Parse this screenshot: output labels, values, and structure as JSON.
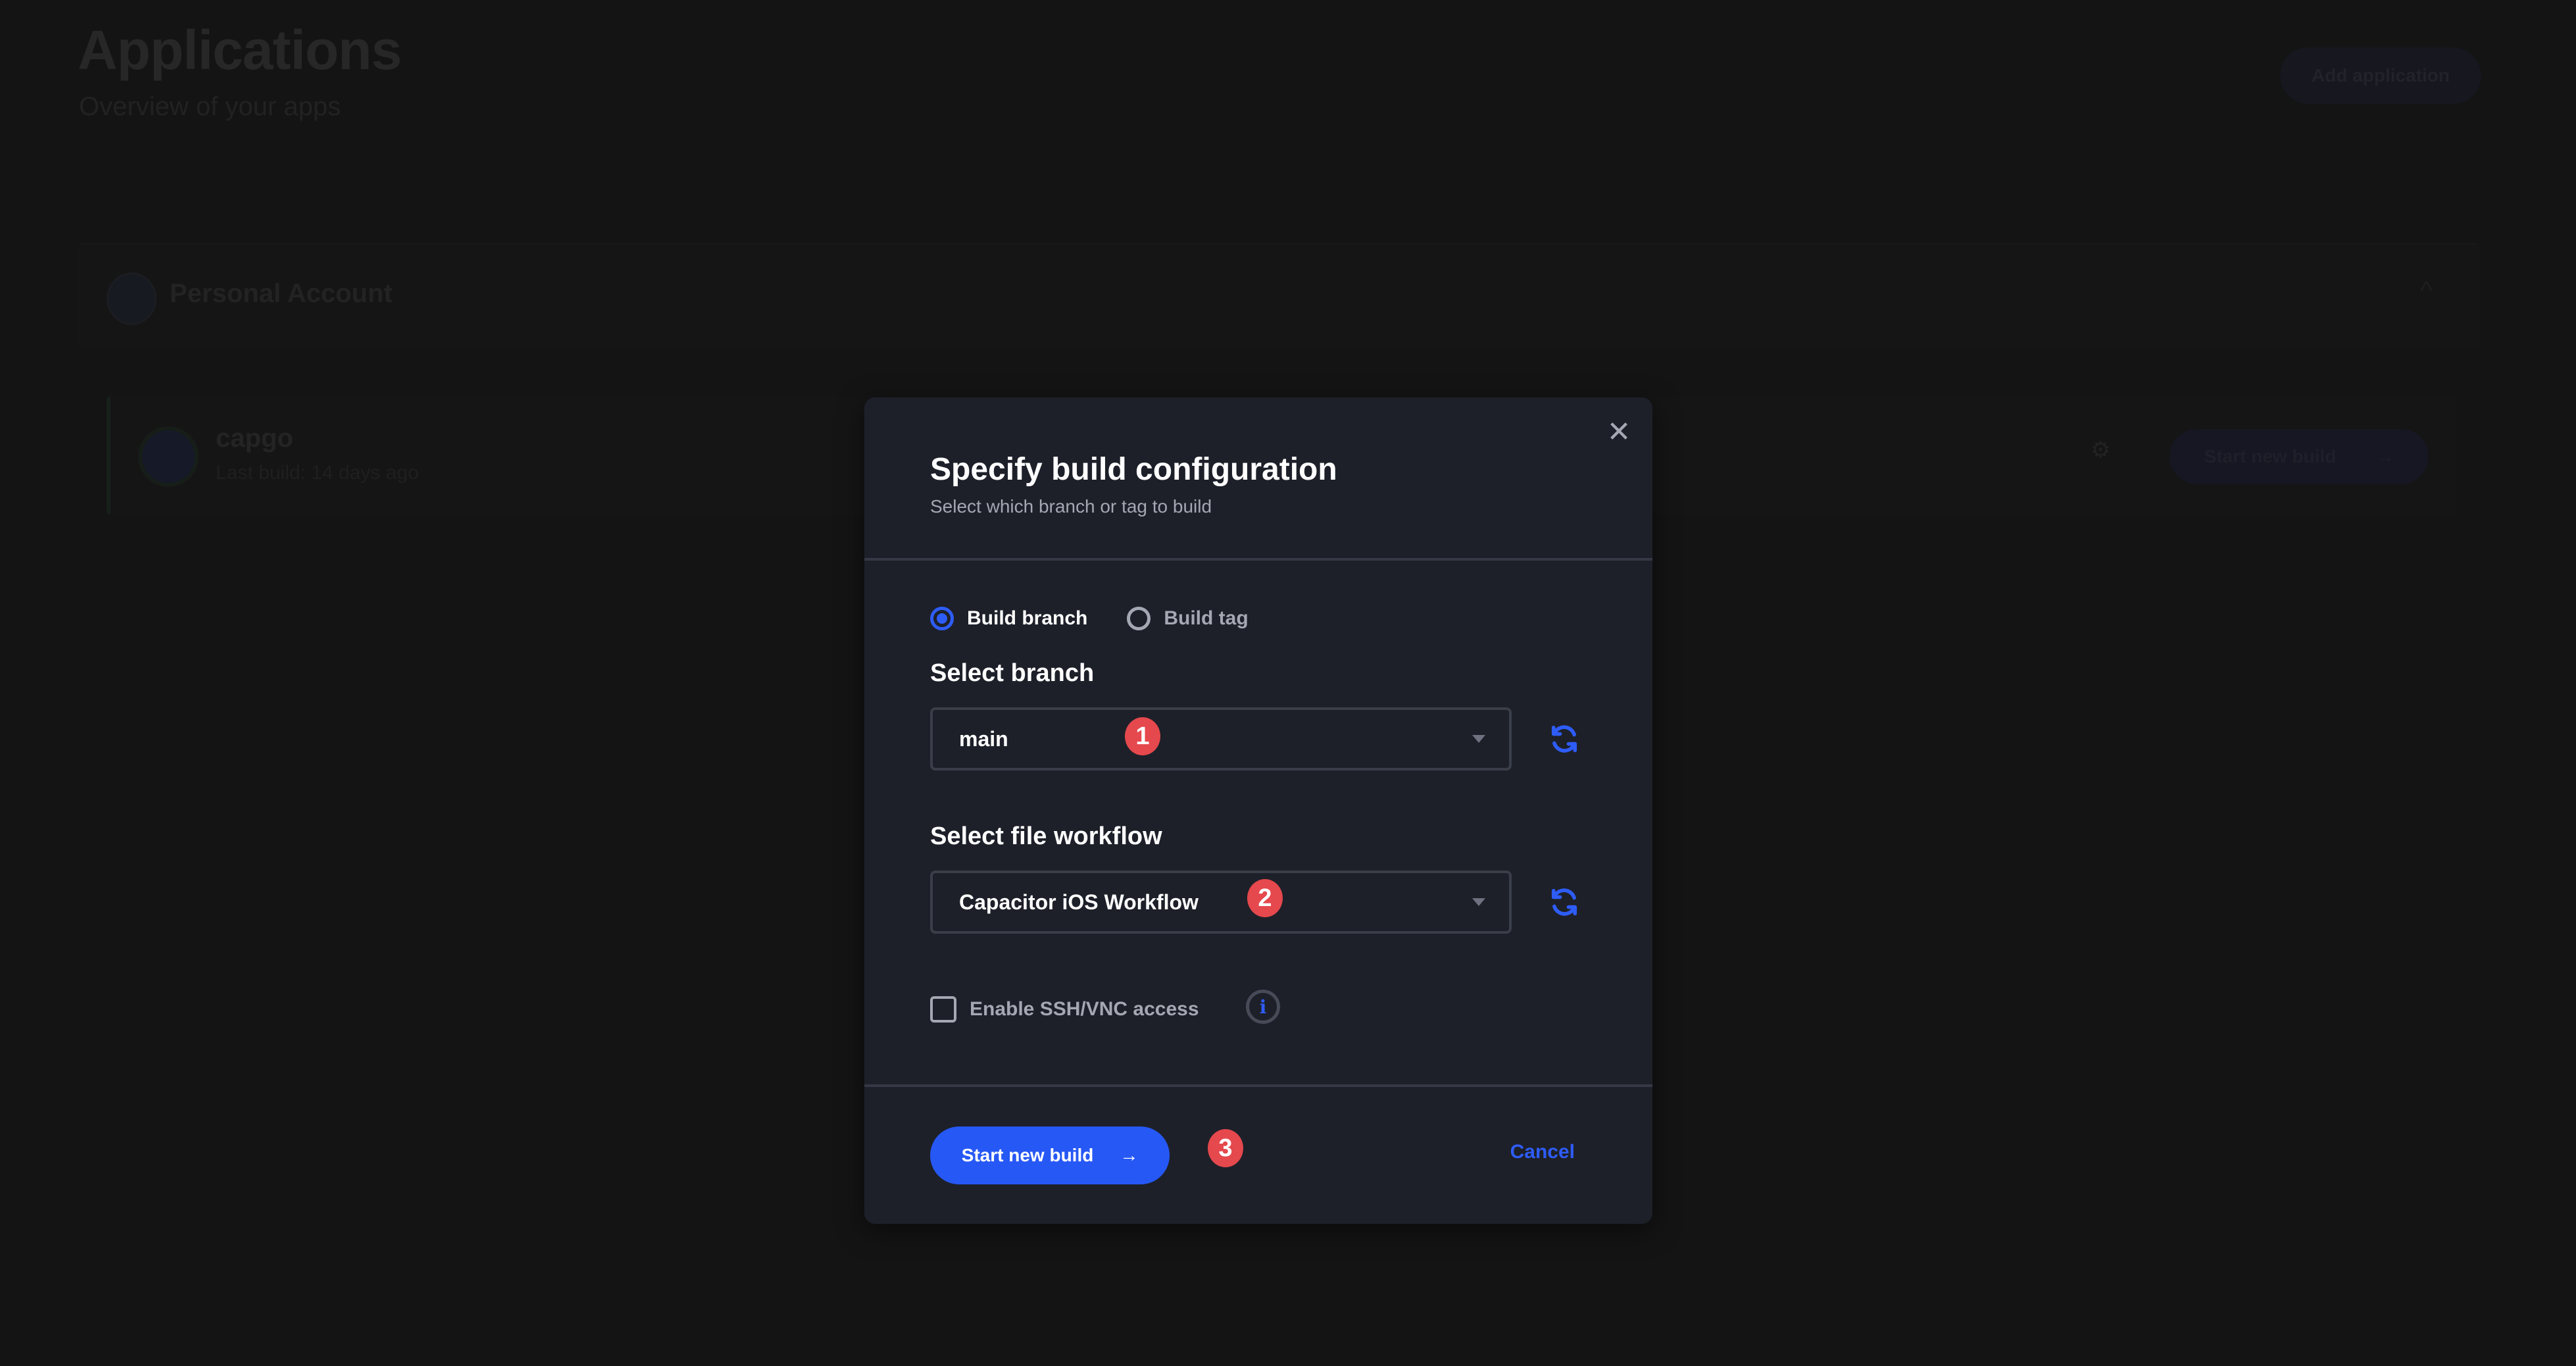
{
  "page": {
    "title": "Applications",
    "subtitle": "Overview of your apps",
    "add_application_label": "Add application",
    "account": {
      "name": "Personal Account",
      "chevron": "^"
    },
    "apps": [
      {
        "name": "capgo",
        "meta": "Last build: 14 days ago",
        "start_build_label": "Start new build",
        "arrow": "→",
        "gear": "⚙"
      }
    ]
  },
  "modal": {
    "title": "Specify build configuration",
    "subtitle": "Select which branch or tag to build",
    "close_glyph": "✕",
    "build_type": {
      "options": [
        {
          "label": "Build branch",
          "checked": true
        },
        {
          "label": "Build tag",
          "checked": false
        }
      ]
    },
    "branch": {
      "label": "Select branch",
      "value": "main",
      "badge": "1"
    },
    "workflow": {
      "label": "Select file workflow",
      "value": "Capacitor iOS Workflow",
      "badge": "2"
    },
    "ssh": {
      "label": "Enable SSH/VNC access",
      "checked": false,
      "info_glyph": "i"
    },
    "footer": {
      "start_label": "Start new build",
      "start_arrow": "→",
      "badge": "3",
      "cancel_label": "Cancel"
    }
  },
  "colors": {
    "accent": "#2658f5",
    "badge": "#e5484d",
    "modal_bg": "#1d2029",
    "page_bg": "#141414"
  }
}
